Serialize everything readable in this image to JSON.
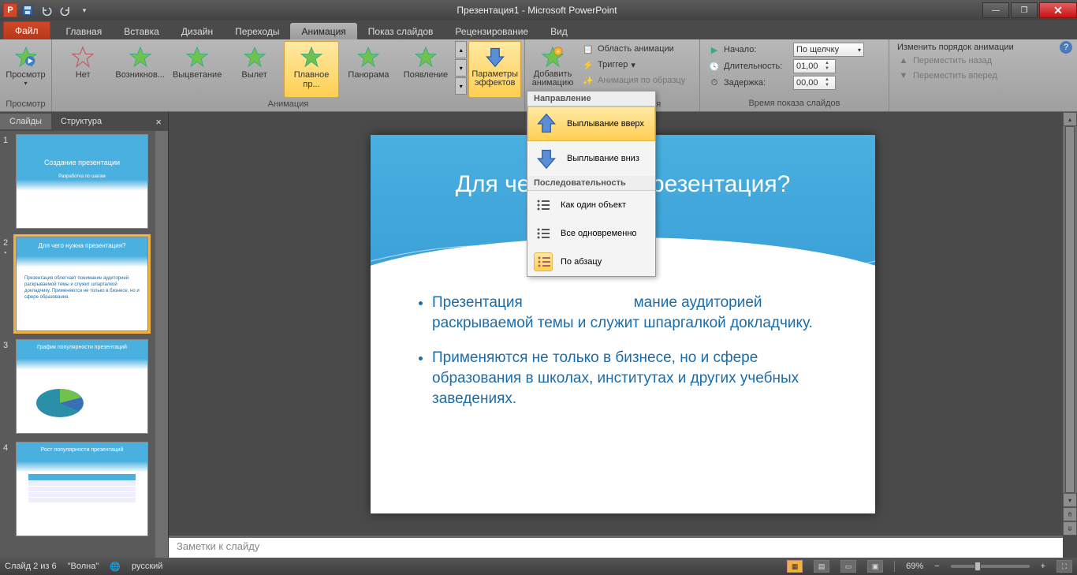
{
  "title": "Презентация1 - Microsoft PowerPoint",
  "qat": {
    "save": "save",
    "undo": "undo",
    "redo": "redo"
  },
  "tabs": {
    "file": "Файл",
    "items": [
      "Главная",
      "Вставка",
      "Дизайн",
      "Переходы",
      "Анимация",
      "Показ слайдов",
      "Рецензирование",
      "Вид"
    ],
    "active_index": 4
  },
  "ribbon": {
    "preview": {
      "btn": "Просмотр",
      "group": "Просмотр"
    },
    "animation": {
      "group": "Анимация",
      "items": [
        "Нет",
        "Возникнов...",
        "Выцветание",
        "Вылет",
        "Плавное пр...",
        "Панорама",
        "Появление"
      ],
      "selected_index": 4,
      "effect_options": "Параметры эффектов"
    },
    "advanced": {
      "group": "Расширенная анимация",
      "add": "Добавить анимацию",
      "pane": "Область анимации",
      "trigger": "Триггер",
      "painter": "Анимация по образцу"
    },
    "timing": {
      "group": "Время показа слайдов",
      "start_label": "Начало:",
      "start_value": "По щелчку",
      "duration_label": "Длительность:",
      "duration_value": "01,00",
      "delay_label": "Задержка:",
      "delay_value": "00,00"
    },
    "reorder": {
      "title": "Изменить порядок анимации",
      "earlier": "Переместить назад",
      "later": "Переместить вперед"
    }
  },
  "menu": {
    "section1": "Направление",
    "up": "Выплывание вверх",
    "down": "Выплывание вниз",
    "section2": "Последовательность",
    "one": "Как один объект",
    "all": "Все одновременно",
    "para": "По абзацу"
  },
  "left_pane": {
    "tab_slides": "Слайды",
    "tab_outline": "Структура",
    "thumbs": [
      {
        "n": "1",
        "title": "Создание презентации",
        "sub": "Разработка по шагам"
      },
      {
        "n": "2",
        "title": "Для чего нужна презентация?",
        "lines": "Презентация облегчает понимание аудиторией раскрываемой темы и служит шпаргалкой докладчику. Применяются не только в бизнесе, но и сфере образования."
      },
      {
        "n": "3",
        "title": "График популярности презентаций"
      },
      {
        "n": "4",
        "title": "Рост популярности презентаций"
      }
    ],
    "selected_index": 1
  },
  "slide": {
    "title": "Для чего нужна презентация?",
    "title_visible_left": "Для чего",
    "title_visible_right": "резентация?",
    "bullets": [
      {
        "pre": "Презентация",
        "mid_hidden": true,
        "mid": "мание аудиторией раскрываемой темы и служит шпаргалкой докладчику."
      },
      {
        "text": "Применяются не только в бизнесе, но и сфере образования в школах, институтах и других учебных заведениях."
      }
    ]
  },
  "notes_placeholder": "Заметки к слайду",
  "status": {
    "slide_of": "Слайд 2 из 6",
    "theme": "\"Волна\"",
    "lang": "русский",
    "zoom": "69%"
  }
}
